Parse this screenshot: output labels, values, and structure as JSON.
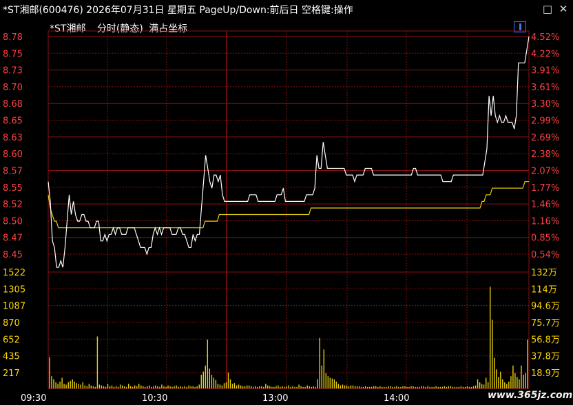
{
  "window": {
    "title": "*ST湘邮(600476) 2026年07月31日 星期五 PageUp/Down:前后日 空格键:操作",
    "minimize_label": "□",
    "close_label": "✕"
  },
  "header": {
    "stock_name": "*ST湘邮",
    "mode": "分时(静态)",
    "axis_mode": "满占坐标"
  },
  "watermark": "www.365jz.com",
  "colors": {
    "background": "#000000",
    "grid": "#8b1010",
    "price_axis": "#ff4040",
    "volume_axis": "#ffd700",
    "price_line": "#ffffff",
    "avg_line": "#e8d20a",
    "volume_bar": "#e8d20a",
    "time_axis": "#ffffff"
  },
  "chart_data": [
    {
      "type": "line",
      "title": "",
      "y_ticks": [
        "8.78",
        "8.75",
        "8.73",
        "8.70",
        "8.68",
        "8.65",
        "8.63",
        "8.60",
        "8.57",
        "8.55",
        "8.52",
        "8.50",
        "8.47",
        "8.45"
      ],
      "y_pct_ticks": [
        "4.52%",
        "4.22%",
        "3.91%",
        "3.61%",
        "3.30%",
        "2.99%",
        "2.69%",
        "2.38%",
        "2.07%",
        "1.77%",
        "1.46%",
        "1.16%",
        "0.85%",
        "0.54%"
      ],
      "ylim": [
        8.42,
        8.79
      ],
      "x_time_ticks": [
        "09:30",
        "10:30",
        "13:00",
        "14:00"
      ],
      "series": [
        {
          "values": [
            8.56,
            8.53,
            8.47,
            8.46,
            8.43,
            8.43,
            8.44,
            8.43,
            8.46,
            8.5,
            8.54,
            8.51,
            8.53,
            8.51,
            8.5,
            8.5,
            8.51,
            8.51,
            8.5,
            8.5,
            8.49,
            8.49,
            8.49,
            8.5,
            8.5,
            8.47,
            8.47,
            8.48,
            8.47,
            8.48,
            8.48,
            8.49,
            8.48,
            8.49,
            8.49,
            8.48,
            8.48,
            8.48,
            8.49,
            8.49,
            8.49,
            8.49,
            8.48,
            8.47,
            8.46,
            8.46,
            8.46,
            8.45,
            8.46,
            8.46,
            8.48,
            8.49,
            8.48,
            8.49,
            8.48,
            8.49,
            8.49,
            8.49,
            8.49,
            8.48,
            8.48,
            8.48,
            8.49,
            8.49,
            8.48,
            8.48,
            8.47,
            8.46,
            8.46,
            8.48,
            8.47,
            8.48,
            8.48,
            8.52,
            8.56,
            8.6,
            8.58,
            8.56,
            8.55,
            8.57,
            8.57,
            8.56,
            8.57,
            8.54,
            8.53,
            8.53,
            8.53,
            8.53,
            8.53,
            8.53,
            8.53,
            8.53,
            8.53,
            8.53,
            8.53,
            8.53,
            8.54,
            8.54,
            8.54,
            8.54,
            8.53,
            8.53,
            8.53,
            8.53,
            8.53,
            8.53,
            8.53,
            8.53,
            8.53,
            8.54,
            8.54,
            8.54,
            8.55,
            8.53,
            8.53,
            8.53,
            8.53,
            8.53,
            8.53,
            8.53,
            8.53,
            8.53,
            8.53,
            8.54,
            8.54,
            8.54,
            8.54,
            8.55,
            8.6,
            8.58,
            8.58,
            8.62,
            8.6,
            8.58,
            8.58,
            8.58,
            8.58,
            8.58,
            8.58,
            8.58,
            8.58,
            8.58,
            8.57,
            8.57,
            8.57,
            8.57,
            8.56,
            8.57,
            8.57,
            8.57,
            8.57,
            8.58,
            8.58,
            8.58,
            8.58,
            8.57,
            8.57,
            8.57,
            8.57,
            8.57,
            8.57,
            8.57,
            8.57,
            8.57,
            8.57,
            8.57,
            8.57,
            8.57,
            8.57,
            8.57,
            8.57,
            8.57,
            8.57,
            8.57,
            8.58,
            8.58,
            8.57,
            8.57,
            8.57,
            8.57,
            8.57,
            8.57,
            8.57,
            8.57,
            8.57,
            8.57,
            8.57,
            8.57,
            8.56,
            8.56,
            8.56,
            8.56,
            8.56,
            8.57,
            8.57,
            8.57,
            8.57,
            8.57,
            8.57,
            8.57,
            8.57,
            8.57,
            8.57,
            8.57,
            8.57,
            8.57,
            8.57,
            8.57,
            8.59,
            8.61,
            8.69,
            8.66,
            8.69,
            8.66,
            8.65,
            8.66,
            8.65,
            8.65,
            8.66,
            8.65,
            8.65,
            8.65,
            8.64,
            8.66,
            8.74,
            8.74,
            8.74,
            8.74,
            8.76,
            8.78
          ]
        },
        {
          "values": [
            8.54,
            8.52,
            8.51,
            8.5,
            8.5,
            8.49,
            8.49,
            8.49,
            8.49,
            8.49,
            8.49,
            8.49,
            8.49,
            8.49,
            8.49,
            8.49,
            8.49,
            8.49,
            8.49,
            8.49,
            8.49,
            8.49,
            8.49,
            8.49,
            8.49,
            8.49,
            8.49,
            8.49,
            8.49,
            8.49,
            8.49,
            8.49,
            8.49,
            8.49,
            8.49,
            8.49,
            8.49,
            8.49,
            8.49,
            8.49,
            8.49,
            8.49,
            8.49,
            8.49,
            8.49,
            8.49,
            8.49,
            8.49,
            8.49,
            8.49,
            8.49,
            8.49,
            8.49,
            8.49,
            8.49,
            8.49,
            8.49,
            8.49,
            8.49,
            8.49,
            8.49,
            8.49,
            8.49,
            8.49,
            8.49,
            8.49,
            8.49,
            8.49,
            8.49,
            8.49,
            8.49,
            8.49,
            8.49,
            8.49,
            8.49,
            8.49,
            8.49,
            8.5,
            8.5,
            8.5,
            8.5,
            8.5,
            8.5,
            8.5,
            8.51,
            8.51,
            8.51,
            8.51,
            8.51,
            8.51,
            8.51,
            8.51,
            8.51,
            8.51,
            8.51,
            8.51,
            8.51,
            8.51,
            8.51,
            8.51,
            8.51,
            8.51,
            8.51,
            8.51,
            8.51,
            8.51,
            8.51,
            8.51,
            8.51,
            8.51,
            8.51,
            8.51,
            8.51,
            8.51,
            8.51,
            8.51,
            8.51,
            8.51,
            8.51,
            8.51,
            8.51,
            8.51,
            8.51,
            8.51,
            8.51,
            8.51,
            8.51,
            8.51,
            8.51,
            8.52,
            8.52,
            8.52,
            8.52,
            8.52,
            8.52,
            8.52,
            8.52,
            8.52,
            8.52,
            8.52,
            8.52,
            8.52,
            8.52,
            8.52,
            8.52,
            8.52,
            8.52,
            8.52,
            8.52,
            8.52,
            8.52,
            8.52,
            8.52,
            8.52,
            8.52,
            8.52,
            8.52,
            8.52,
            8.52,
            8.52,
            8.52,
            8.52,
            8.52,
            8.52,
            8.52,
            8.52,
            8.52,
            8.52,
            8.52,
            8.52,
            8.52,
            8.52,
            8.52,
            8.52,
            8.52,
            8.52,
            8.52,
            8.52,
            8.52,
            8.52,
            8.52,
            8.52,
            8.52,
            8.52,
            8.52,
            8.52,
            8.52,
            8.52,
            8.52,
            8.52,
            8.52,
            8.52,
            8.52,
            8.52,
            8.52,
            8.52,
            8.52,
            8.52,
            8.52,
            8.52,
            8.52,
            8.52,
            8.52,
            8.52,
            8.52,
            8.52,
            8.52,
            8.52,
            8.52,
            8.52,
            8.52,
            8.52,
            8.52,
            8.53,
            8.53,
            8.54,
            8.54,
            8.54,
            8.55,
            8.55,
            8.55,
            8.55,
            8.55,
            8.55,
            8.55,
            8.55,
            8.55,
            8.55,
            8.55,
            8.55,
            8.55,
            8.55,
            8.55,
            8.55,
            8.56,
            8.56,
            8.56
          ]
        }
      ]
    },
    {
      "type": "bar",
      "title": "",
      "y_ticks": [
        "1522",
        "1305",
        "1087",
        "870",
        "652",
        "435",
        "217"
      ],
      "y_right_ticks": [
        "132万",
        "114万",
        "94.6万",
        "75.7万",
        "56.8万",
        "37.8万",
        "18.9万"
      ],
      "ylim": [
        0,
        1522
      ],
      "values": [
        410,
        160,
        120,
        80,
        60,
        90,
        140,
        60,
        50,
        80,
        100,
        120,
        90,
        70,
        60,
        50,
        80,
        40,
        30,
        60,
        40,
        30,
        20,
        680,
        50,
        40,
        30,
        20,
        60,
        30,
        40,
        20,
        30,
        20,
        50,
        40,
        30,
        20,
        60,
        30,
        20,
        40,
        30,
        60,
        40,
        30,
        20,
        30,
        40,
        20,
        30,
        40,
        30,
        20,
        50,
        30,
        20,
        40,
        30,
        20,
        30,
        40,
        20,
        30,
        20,
        30,
        20,
        40,
        30,
        30,
        20,
        30,
        50,
        180,
        220,
        300,
        640,
        260,
        180,
        140,
        110,
        60,
        50,
        40,
        70,
        80,
        210,
        120,
        60,
        70,
        40,
        50,
        40,
        30,
        30,
        40,
        40,
        30,
        20,
        30,
        20,
        30,
        30,
        20,
        60,
        40,
        30,
        20,
        20,
        30,
        40,
        20,
        30,
        20,
        30,
        40,
        20,
        30,
        20,
        20,
        50,
        30,
        20,
        20,
        40,
        30,
        20,
        30,
        20,
        120,
        660,
        300,
        510,
        200,
        160,
        140,
        130,
        120,
        90,
        60,
        40,
        50,
        40,
        40,
        30,
        40,
        40,
        30,
        30,
        30,
        20,
        20,
        30,
        20,
        20,
        20,
        30,
        30,
        20,
        30,
        20,
        20,
        20,
        30,
        30,
        20,
        20,
        30,
        20,
        20,
        30,
        30,
        20,
        20,
        30,
        30,
        20,
        20,
        20,
        30,
        30,
        20,
        30,
        20,
        20,
        20,
        30,
        20,
        20,
        20,
        30,
        20,
        30,
        30,
        20,
        20,
        20,
        20,
        30,
        20,
        20,
        30,
        20,
        20,
        30,
        40,
        120,
        80,
        60,
        50,
        140,
        80,
        1330,
        900,
        400,
        250,
        150,
        220,
        120,
        80,
        60,
        90,
        160,
        300,
        200,
        150,
        120,
        300,
        180,
        200,
        640
      ]
    }
  ]
}
